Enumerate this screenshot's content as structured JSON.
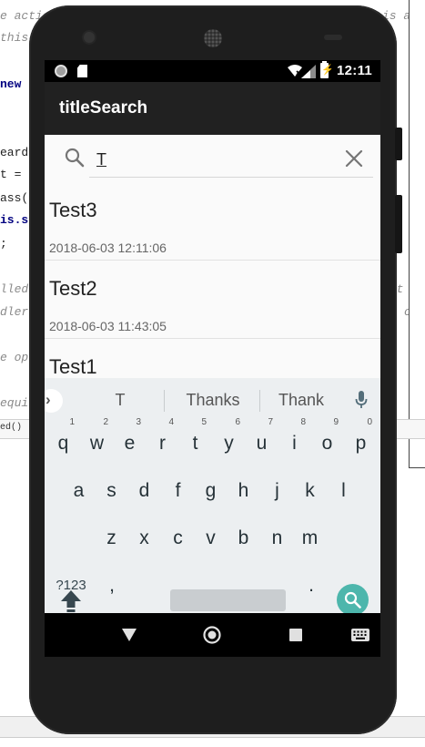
{
  "ide": {
    "left_lines": [
      "e action",
      "this",
      "",
      "new",
      "",
      "",
      "eard",
      "t =",
      "ass(",
      "is.s",
      ";",
      "",
      "lled",
      "dler",
      "",
      "e op",
      "",
      "equi"
    ],
    "right_lines": [
      "is a",
      "",
      "",
      "",
      "))",
      "",
      "",
      "",
      "",
      "",
      "",
      "",
      "Not",
      "c",
      "",
      "",
      "",
      ""
    ],
    "status_text": "ed()"
  },
  "statusbar": {
    "time": "12:11"
  },
  "appbar": {
    "title": "titleSearch"
  },
  "search": {
    "value": "T",
    "placeholder": ""
  },
  "results": [
    {
      "title": "Test3",
      "timestamp": "2018-06-03 12:11:06"
    },
    {
      "title": "Test2",
      "timestamp": "2018-06-03 11:43:05"
    },
    {
      "title": "Test1",
      "timestamp": ""
    }
  ],
  "keyboard": {
    "suggestions": [
      "T",
      "Thanks",
      "Thank"
    ],
    "row1": [
      {
        "key": "q",
        "hint": "1"
      },
      {
        "key": "w",
        "hint": "2"
      },
      {
        "key": "e",
        "hint": "3"
      },
      {
        "key": "r",
        "hint": "4"
      },
      {
        "key": "t",
        "hint": "5"
      },
      {
        "key": "y",
        "hint": "6"
      },
      {
        "key": "u",
        "hint": "7"
      },
      {
        "key": "i",
        "hint": "8"
      },
      {
        "key": "o",
        "hint": "9"
      },
      {
        "key": "p",
        "hint": "0"
      }
    ],
    "row2": [
      "a",
      "s",
      "d",
      "f",
      "g",
      "h",
      "j",
      "k",
      "l"
    ],
    "row3": [
      "z",
      "x",
      "c",
      "v",
      "b",
      "n",
      "m"
    ],
    "symbols_label": "?123",
    "comma": ",",
    "period": "."
  },
  "colors": {
    "appbar": "#212121",
    "keyboard": "#eceff1",
    "enter_key": "#4db6ac",
    "phone_body": "#1e1e1e"
  },
  "icons": {
    "search": "search-icon",
    "clear": "close-icon",
    "mic": "microphone-icon",
    "shift": "shift-icon",
    "backspace": "backspace-icon",
    "emoji": "emoji-icon",
    "nav_back": "back-triangle-icon",
    "nav_home": "home-circle-icon",
    "nav_recent": "recents-square-icon",
    "nav_keyboard": "keyboard-icon"
  }
}
